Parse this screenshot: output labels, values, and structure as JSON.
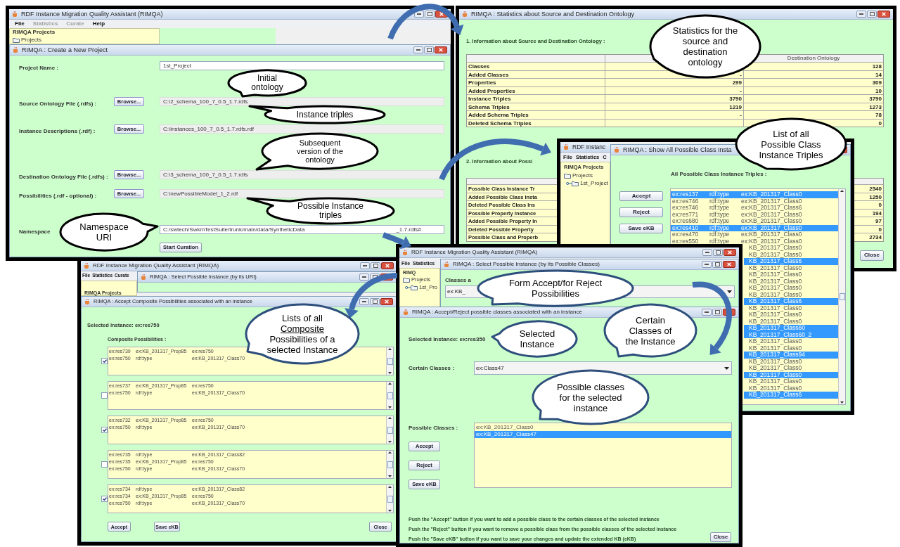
{
  "project_window": {
    "app_title": "RDF Instance Migration Quality Assistant (RIMQA)",
    "menu": [
      {
        "label": "File",
        "disabled": false
      },
      {
        "label": "Statistics",
        "disabled": true
      },
      {
        "label": "Curate",
        "disabled": true
      },
      {
        "label": "Help",
        "disabled": false
      }
    ],
    "projects_title": "RIMQA Projects",
    "tree": {
      "label": "Projects"
    },
    "dialog_title": "RIMQA : Create a New Project",
    "fields": [
      {
        "label": "Project Name :",
        "value": "1st_Project",
        "kind": "text"
      },
      {
        "label": "Source Ontology File (.rdfs) :",
        "button": "Browse...",
        "value": "C:\\2_schema_100_7_0.5_1.7.rdfs",
        "kind": "file"
      },
      {
        "label": "Instance Descriptions (.rdf) :",
        "button": "Browse...",
        "value": "C:\\instances_100_7_0.5_1.7.rdfs.rdf",
        "kind": "file"
      },
      {
        "label": "Destination Ontology File (.rdfs) :",
        "button": "Browse...",
        "value": "C:\\3_schema_100_7_0.5_1.7.rdfs",
        "kind": "file"
      },
      {
        "label": "Possibilities (.rdf - optional) :",
        "button": "Browse...",
        "value": "C:\\newPossibleModel_1_2.rdf",
        "kind": "file"
      },
      {
        "label": "Namespace",
        "value": "C:/swtech/SwkmTestSuite/trunk/main/data/SyntheticData",
        "value_end": "_1.7.rdfs#",
        "kind": "text"
      }
    ],
    "start_button": "Start Curation"
  },
  "stats_window": {
    "title": "RIMQA : Statistics about Source and Destination Ontology",
    "section_1": "1. Information about Source and Destination Ontology :",
    "destination_header": "Destination Ontology",
    "rows_1": [
      {
        "label": "Classes",
        "destination": "128"
      },
      {
        "label": "Added Classes",
        "source": "-",
        "destination": "14"
      },
      {
        "label": "Properties",
        "source": "299",
        "destination": "309"
      },
      {
        "label": "Added Properties",
        "source": "-",
        "destination": "10"
      },
      {
        "label": "Instance Triples",
        "source": "3790",
        "destination": "3790"
      },
      {
        "label": "Schema Triples",
        "source": "1219",
        "destination": "1273"
      },
      {
        "label": "Added Schema Triples",
        "source": "-",
        "destination": "78"
      },
      {
        "label": "Deleted Schema Triples",
        "destination": "0"
      }
    ],
    "section_2": "2. Information about Possi",
    "rows_2": [
      {
        "label": "Possible Class Instance Tr",
        "value": "2540"
      },
      {
        "label": "Added Possible Class Insta",
        "value": "1250"
      },
      {
        "label": "Deleted Possible Class Ins",
        "value": "0"
      },
      {
        "label": "Possible Property Instance",
        "value": "194"
      },
      {
        "label": "Added Possible Property In",
        "value": "97"
      },
      {
        "label": "Deleted Possible Property",
        "value": "0"
      },
      {
        "label": "Possible Class and Properb",
        "value": "2734"
      }
    ],
    "close_button": "Close"
  },
  "triples_window": {
    "app_title": "RDF Instanc",
    "menu": [
      {
        "label": "File",
        "disabled": false
      },
      {
        "label": "Statistics",
        "disabled": false
      },
      {
        "label": "C",
        "disabled": false
      }
    ],
    "projects_title": "RIMQA Projects",
    "tree": {
      "label": "Projects",
      "children": [
        {
          "label": "1st_Project"
        }
      ]
    },
    "dialog_title": "RIMQA : Show All Possible Class Insta",
    "heading": "All Possible Class Instance Triples :",
    "buttons": [
      "Accept",
      "Reject",
      "Save eKB"
    ],
    "rows": [
      {
        "subject": "ex:res137",
        "predicate": "rdf:type",
        "object": "ex:KB_201317_Class0",
        "selected": true
      },
      {
        "subject": "ex:res746",
        "predicate": "rdf:type",
        "object": "ex:KB_201317_Class0",
        "selected": false
      },
      {
        "subject": "ex:res746",
        "predicate": "rdf:type",
        "object": "ex:KB_201317_Class6",
        "selected": false
      },
      {
        "subject": "ex:res771",
        "predicate": "rdf:type",
        "object": "ex:KB_201317_Class0",
        "selected": false
      },
      {
        "subject": "ex:res680",
        "predicate": "rdf:type",
        "object": "ex:KB_201317_Class0",
        "selected": false
      },
      {
        "subject": "ex:res410",
        "predicate": "rdf:type",
        "object": "ex:KB_201317_Class0",
        "selected": true
      },
      {
        "subject": "ex:res470",
        "predicate": "rdf:type",
        "object": "ex:KB_201317_Class0",
        "selected": false
      },
      {
        "subject": "ex:res550",
        "predicate": "rdf:type",
        "object": "ex:KB_201317_Class0",
        "selected": false
      },
      {
        "object": "KB_201317_Class0",
        "selected": false
      },
      {
        "object": "KB_201317_Class0",
        "selected": false
      },
      {
        "object": "KB_201317_Class6",
        "selected": true
      },
      {
        "object": "KB_201317_Class0",
        "selected": false
      },
      {
        "object": "KB_201317_Class0",
        "selected": false
      },
      {
        "object": "KB_201317_Class0",
        "selected": false
      },
      {
        "object": "KB_201317_Class0",
        "selected": false
      },
      {
        "object": "KB_201317_Class0",
        "selected": false
      },
      {
        "object": "KB_201317_Class6",
        "selected": true
      },
      {
        "object": "KB_201317_Class0",
        "selected": false
      },
      {
        "object": "KB_201317_Class0",
        "selected": false
      },
      {
        "object": "KB_201317_Class0",
        "selected": false
      },
      {
        "object": "KB_201317_Class60",
        "selected": true
      },
      {
        "object": "KB_201317_Class60_2",
        "selected": true
      },
      {
        "object": "KB_201317_Class0",
        "selected": false
      },
      {
        "object": "KB_201317_Class0",
        "selected": false
      },
      {
        "object": "KB_201317_Class94",
        "selected": true
      },
      {
        "object": "KB_201317_Class0",
        "selected": false
      },
      {
        "object": "KB_201317_Class0",
        "selected": false
      },
      {
        "object": "KB_201317_Class0",
        "selected": true
      },
      {
        "object": "KB_201317_Class0",
        "selected": false
      },
      {
        "object": "KB_201317_Class0",
        "selected": false
      },
      {
        "object": "KB_201317_Class6",
        "selected": true
      }
    ]
  },
  "composite_window": {
    "app_title": "RDF Instance Migration Quality Assistant (RIMQA)",
    "menu": [
      {
        "label": "File",
        "disabled": false
      },
      {
        "label": "Statistics",
        "disabled": false
      },
      {
        "label": "Curate",
        "disabled": false
      }
    ],
    "projects_title": "RIMQA Projects",
    "uri_dialog_title": "RIMQA : Select Possible Instance (by its URI)",
    "dialog_title": "RIMQA : Accept Composite Possibilities associated with an instance",
    "selected_instance": "Selected Instance: ex:res750",
    "list_label": "Composite Possibilities :",
    "possibilities": [
      {
        "checked": true,
        "triples": [
          [
            "ex:res739",
            "ex:KB_201317_Prop85",
            "ex:res750"
          ],
          [
            "ex:res750",
            "rdf:type",
            "ex:KB_201317_Class70"
          ]
        ]
      },
      {
        "checked": false,
        "triples": [
          [
            "ex:res737",
            "ex:KB_201317_Prop85",
            "ex:res750"
          ],
          [
            "ex:res750",
            "rdf:type",
            "ex:KB_201317_Class70"
          ]
        ]
      },
      {
        "checked": true,
        "triples": [
          [
            "ex:res732",
            "ex:KB_201317_Prop85",
            "ex:res750"
          ],
          [
            "ex:res750",
            "rdf:type",
            "ex:KB_201317_Class70"
          ]
        ]
      },
      {
        "checked": false,
        "triples": [
          [
            "ex:res735",
            "rdf:type",
            "ex:KB_201317_Class82"
          ],
          [
            "ex:res735",
            "ex:KB_201317_Prop85",
            "ex:res750"
          ],
          [
            "ex:res750",
            "rdf:type",
            "ex:KB_201317_Class70"
          ]
        ]
      },
      {
        "checked": true,
        "triples": [
          [
            "ex:res734",
            "rdf:type",
            "ex:KB_201317_Class82"
          ],
          [
            "ex:res734",
            "ex:KB_201317_Prop85",
            "ex:res750"
          ],
          [
            "ex:res750",
            "rdf:type",
            "ex:KB_201317_Class70"
          ]
        ]
      }
    ],
    "buttons": [
      "Accept",
      "Save eKB"
    ],
    "close_button": "Close"
  },
  "classes_window": {
    "app_title": "RDF Instance Migration Quality Assistant (RIMQA)",
    "menu": [
      {
        "label": "File",
        "disabled": false
      },
      {
        "label": "Statistics",
        "disabled": false
      }
    ],
    "projects_title": "RIMQ",
    "tree": {
      "label": "Projects",
      "children": [
        {
          "label": "1st_Pro"
        }
      ]
    },
    "select_dialog_title": "RIMQA : Select Possible Instance (by its Possible Classes)",
    "classes_label": "Classes a",
    "classes_value": "ex:KB_",
    "dialog_title": "RIMQA : Accept/Reject possible classes associated with an instance",
    "selected_instance": "Selected Instance: ex:res350",
    "certain_label": "Certain Classes :",
    "certain_value": "ex:Class47",
    "possible_label": "Possible Classes :",
    "possible_classes": [
      {
        "label": "ex:KB_201317_Class0",
        "selected": false
      },
      {
        "label": "ex:KB_201317_Class47",
        "selected": true
      }
    ],
    "buttons": [
      "Accept",
      "Reject",
      "Save eKB"
    ],
    "help": [
      "Push the \"Accept\" button if you want to add a possible class to the certain classes of the selected instance",
      "Push the \"Reject\" button if you want to remove a possible class from the possible classes of the selected instance",
      "Push the \"Save eKB\" button if you want to save your changes and update the extended KB (eKB)"
    ],
    "close_button": "Close"
  },
  "callouts": [
    {
      "color": "#000000",
      "lines": [
        {
          "text": "Initial",
          "underline": false
        },
        {
          "text": "ontology",
          "underline": false
        }
      ]
    },
    {
      "color": "#000000",
      "lines": [
        {
          "text": "Instance triples",
          "underline": false
        }
      ]
    },
    {
      "color": "#000000",
      "lines": [
        {
          "text": "Subsequent",
          "underline": false
        },
        {
          "text": "version of the",
          "underline": false
        },
        {
          "text": "ontology",
          "underline": false
        }
      ]
    },
    {
      "color": "#000000",
      "lines": [
        {
          "text": "Possible Instance",
          "underline": false
        },
        {
          "text": "triples",
          "underline": false
        }
      ]
    },
    {
      "color": "#000000",
      "lines": [
        {
          "text": "Namespace",
          "underline": false
        },
        {
          "text": "URI",
          "underline": false
        }
      ]
    },
    {
      "color": "#000000",
      "lines": [
        {
          "text": "Statistics for the",
          "underline": false
        },
        {
          "text": "source and",
          "underline": false
        },
        {
          "text": "destination",
          "underline": false
        },
        {
          "text": "ontology",
          "underline": false
        }
      ]
    },
    {
      "color": "#000000",
      "lines": [
        {
          "text": "List of all",
          "underline": false
        },
        {
          "text": "Possible Class",
          "underline": false
        },
        {
          "text": "Instance Triples",
          "underline": false
        }
      ]
    },
    {
      "color": "#2e4f7c",
      "lines": [
        {
          "text": "Lists of all",
          "underline": false
        },
        {
          "text": "Composite",
          "underline": true
        },
        {
          "text": "Possibilities of a",
          "underline": false
        },
        {
          "text": "selected Instance",
          "underline": false
        }
      ]
    },
    {
      "color": "#2e4f7c",
      "lines": [
        {
          "text": "Form Accept/for Reject",
          "underline": false
        },
        {
          "text": "Possibilities",
          "underline": false
        }
      ]
    },
    {
      "color": "#2e4f7c",
      "lines": [
        {
          "text": "Selected",
          "underline": false
        },
        {
          "text": "Instance",
          "underline": false
        }
      ]
    },
    {
      "color": "#2e4f7c",
      "lines": [
        {
          "text": "Certain",
          "underline": false
        },
        {
          "text": "Classes of",
          "underline": false
        },
        {
          "text": "the Instance",
          "underline": false
        }
      ]
    },
    {
      "color": "#2e4f7c",
      "lines": [
        {
          "text": "Possible classes",
          "underline": false
        },
        {
          "text": "for the selected",
          "underline": false
        },
        {
          "text": "instance",
          "underline": false
        }
      ]
    }
  ]
}
